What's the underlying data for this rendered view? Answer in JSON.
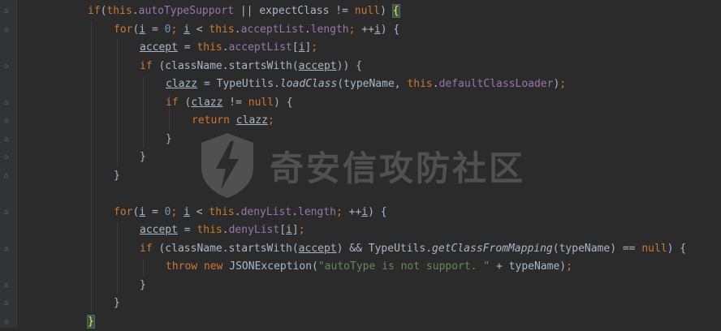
{
  "editor": {
    "watermark_text": "奇安信攻防社区",
    "lines": [
      [
        [
          "kw",
          "if"
        ],
        [
          "",
          "("
        ],
        [
          "kw",
          "this"
        ],
        [
          "",
          "."
        ],
        [
          "fld",
          "autoTypeSupport"
        ],
        [
          "",
          " || expectClass != "
        ],
        [
          "kw",
          "null"
        ],
        [
          "",
          ") "
        ],
        [
          "brace-hl",
          "{"
        ]
      ],
      [
        [
          "kw",
          "for"
        ],
        [
          "",
          "("
        ],
        [
          "ul",
          "i"
        ],
        [
          "",
          " = "
        ],
        [
          "num",
          "0"
        ],
        [
          "kw",
          ";"
        ],
        [
          "",
          " "
        ],
        [
          "ul",
          "i"
        ],
        [
          "",
          " < "
        ],
        [
          "kw",
          "this"
        ],
        [
          "",
          "."
        ],
        [
          "fld",
          "acceptList"
        ],
        [
          "",
          "."
        ],
        [
          "fld",
          "length"
        ],
        [
          "kw",
          ";"
        ],
        [
          "",
          " ++"
        ],
        [
          "ul",
          "i"
        ],
        [
          "",
          ") {"
        ]
      ],
      [
        [
          "ul",
          "accept"
        ],
        [
          "",
          " = "
        ],
        [
          "kw",
          "this"
        ],
        [
          "",
          "."
        ],
        [
          "fld",
          "acceptList"
        ],
        [
          "",
          "["
        ],
        [
          "ul",
          "i"
        ],
        [
          "",
          "]"
        ],
        [
          "kw",
          ";"
        ]
      ],
      [
        [
          "kw",
          "if"
        ],
        [
          "",
          " (className.startsWith("
        ],
        [
          "ul",
          "accept"
        ],
        [
          "",
          ")) {"
        ]
      ],
      [
        [
          "ul",
          "clazz"
        ],
        [
          "",
          " = TypeUtils."
        ],
        [
          "it",
          "loadClass"
        ],
        [
          "",
          "(typeName, "
        ],
        [
          "kw",
          "this"
        ],
        [
          "",
          "."
        ],
        [
          "fld",
          "defaultClassLoader"
        ],
        [
          "",
          ")"
        ],
        [
          "kw",
          ";"
        ]
      ],
      [
        [
          "kw",
          "if"
        ],
        [
          "",
          " ("
        ],
        [
          "ul",
          "clazz"
        ],
        [
          "",
          " != "
        ],
        [
          "kw",
          "null"
        ],
        [
          "",
          ") {"
        ]
      ],
      [
        [
          "kw",
          "return "
        ],
        [
          "ul",
          "clazz"
        ],
        [
          "kw",
          ";"
        ]
      ],
      [
        [
          "",
          "}"
        ]
      ],
      [
        [
          "",
          "}"
        ]
      ],
      [
        [
          "",
          "}"
        ]
      ],
      [],
      [
        [
          "kw",
          "for"
        ],
        [
          "",
          "("
        ],
        [
          "ul",
          "i"
        ],
        [
          "",
          " = "
        ],
        [
          "num",
          "0"
        ],
        [
          "kw",
          ";"
        ],
        [
          "",
          " "
        ],
        [
          "ul",
          "i"
        ],
        [
          "",
          " < "
        ],
        [
          "kw",
          "this"
        ],
        [
          "",
          "."
        ],
        [
          "fld",
          "denyList"
        ],
        [
          "",
          "."
        ],
        [
          "fld",
          "length"
        ],
        [
          "kw",
          ";"
        ],
        [
          "",
          " ++"
        ],
        [
          "ul",
          "i"
        ],
        [
          "",
          ") {"
        ]
      ],
      [
        [
          "ul",
          "accept"
        ],
        [
          "",
          " = "
        ],
        [
          "kw",
          "this"
        ],
        [
          "",
          "."
        ],
        [
          "fld",
          "denyList"
        ],
        [
          "",
          "["
        ],
        [
          "ul",
          "i"
        ],
        [
          "",
          "]"
        ],
        [
          "kw",
          ";"
        ]
      ],
      [
        [
          "kw",
          "if"
        ],
        [
          "",
          " (className.startsWith("
        ],
        [
          "ul",
          "accept"
        ],
        [
          "",
          ") && TypeUtils."
        ],
        [
          "it",
          "getClassFromMapping"
        ],
        [
          "",
          "(typeName) == "
        ],
        [
          "kw",
          "null"
        ],
        [
          "",
          ") {"
        ]
      ],
      [
        [
          "kw",
          "throw new "
        ],
        [
          "",
          "JSONException("
        ],
        [
          "str",
          "\"autoType is not support. \""
        ],
        [
          "",
          " + typeName)"
        ],
        [
          "kw",
          ";"
        ]
      ],
      [
        [
          "",
          "}"
        ]
      ],
      [
        [
          "",
          "}"
        ]
      ],
      [
        [
          "brace-hl",
          "}"
        ]
      ]
    ]
  }
}
